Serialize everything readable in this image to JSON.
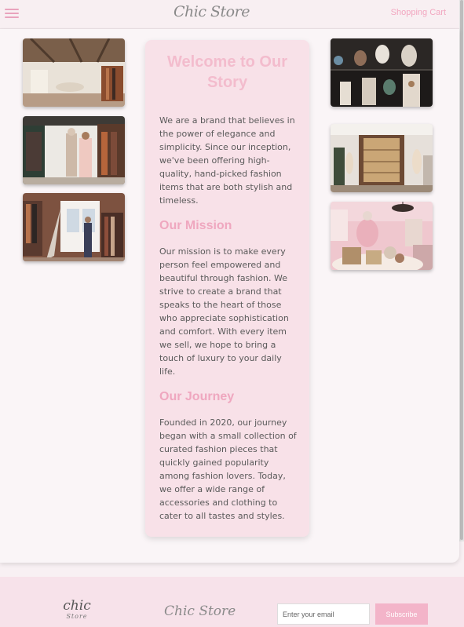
{
  "header": {
    "brand": "Chic Store",
    "cart_link": "Shopping Cart"
  },
  "story": {
    "title": "Welcome to Our Story",
    "intro": "We are a brand that believes in the power of elegance and simplicity. Since our inception, we've been offering high-quality, hand-picked fashion items that are both stylish and timeless.",
    "mission_heading": "Our Mission",
    "mission_text": "Our mission is to make every person feel empowered and beautiful through fashion. We strive to create a brand that speaks to the heart of those who appreciate sophistication and comfort. With every item we sell, we hope to bring a touch of luxury to your daily life.",
    "journey_heading": "Our Journey",
    "journey_text": "Founded in 2020, our journey began with a small collection of curated fashion pieces that quickly gained popularity among fashion lovers. Today, we offer a wide range of accessories and clothing to cater to all tastes and styles."
  },
  "footer": {
    "logo_main": "chic",
    "logo_sub": "Store",
    "brand": "Chic Store",
    "email_placeholder": "Enter your email",
    "subscribe_label": "Subscribe"
  },
  "colors": {
    "accent_pink": "#f2a7c0",
    "panel_pink": "#f8e1e8",
    "heading_pink": "#efa7bf"
  }
}
